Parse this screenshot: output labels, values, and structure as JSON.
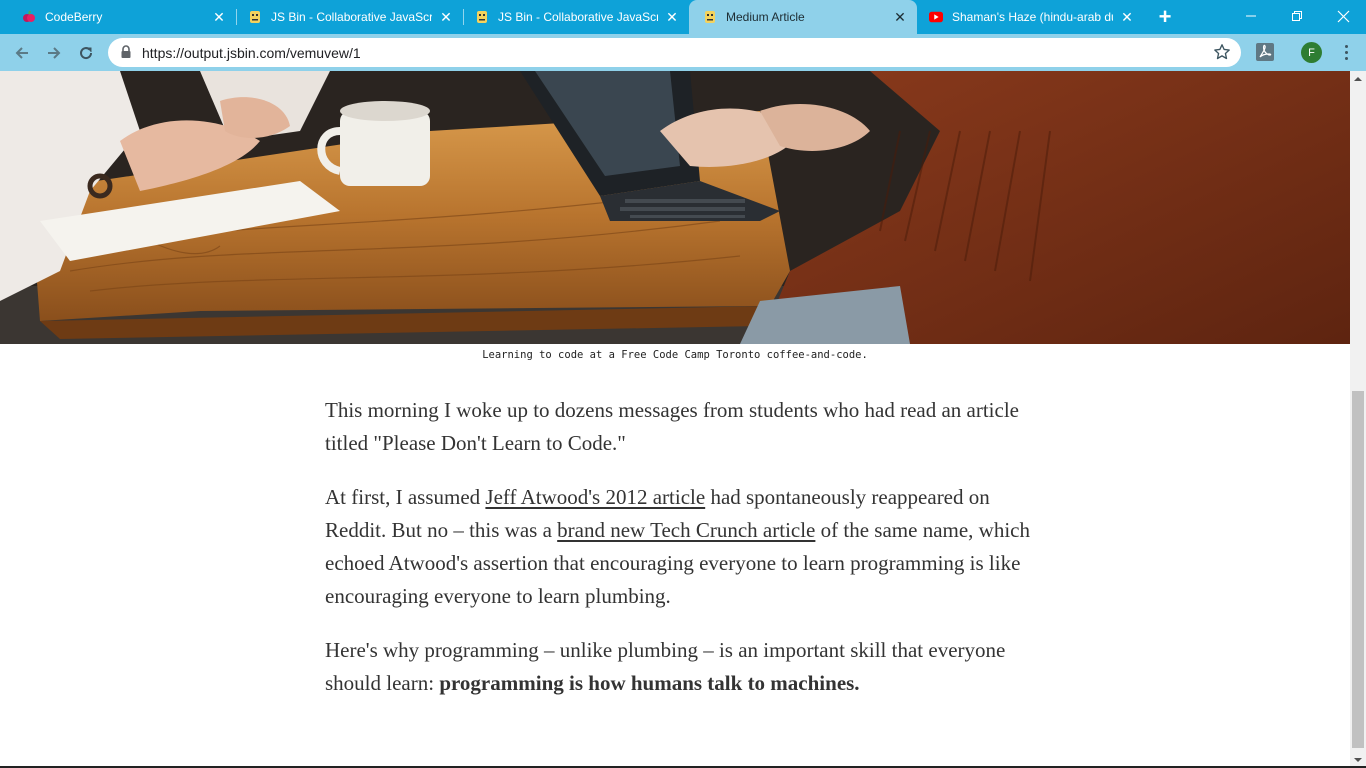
{
  "browser": {
    "tabs": [
      {
        "title": "CodeBerry",
        "favicon": "codeberry-icon",
        "active": false
      },
      {
        "title": "JS Bin - Collaborative JavaScript",
        "favicon": "jsbin-icon",
        "active": false
      },
      {
        "title": "JS Bin - Collaborative JavaScript",
        "favicon": "jsbin-icon",
        "active": false
      },
      {
        "title": "Medium Article",
        "favicon": "jsbin-icon",
        "active": true
      },
      {
        "title": "Shaman's Haze (hindu-arab du",
        "favicon": "youtube-icon",
        "active": false
      }
    ],
    "new_tab_label": "+",
    "url": "https://output.jsbin.com/vemuvew/1",
    "profile_initial": "F"
  },
  "colors": {
    "tab_strip": "#0ea2d8",
    "toolbar": "#8fd1ea",
    "text": "#333333"
  },
  "article": {
    "image_caption": "Learning to code at a Free Code Camp Toronto coffee-and-code.",
    "p1": "This morning I woke up to dozens messages from students who had read an article titled \"Please Don't Learn to Code.\"",
    "p2_before": "At first, I assumed ",
    "p2_link1": "Jeff Atwood's 2012 article",
    "p2_mid": " had spontaneously reappeared on Reddit. But no – this was a ",
    "p2_link2": "brand new Tech Crunch article",
    "p2_after": " of the same name, which echoed Atwood's assertion that encouraging everyone to learn programming is like encouraging everyone to learn plumbing.",
    "p3_before": "Here's why programming – unlike plumbing – is an important skill that everyone should learn: ",
    "p3_bold": "programming is how humans talk to machines."
  }
}
